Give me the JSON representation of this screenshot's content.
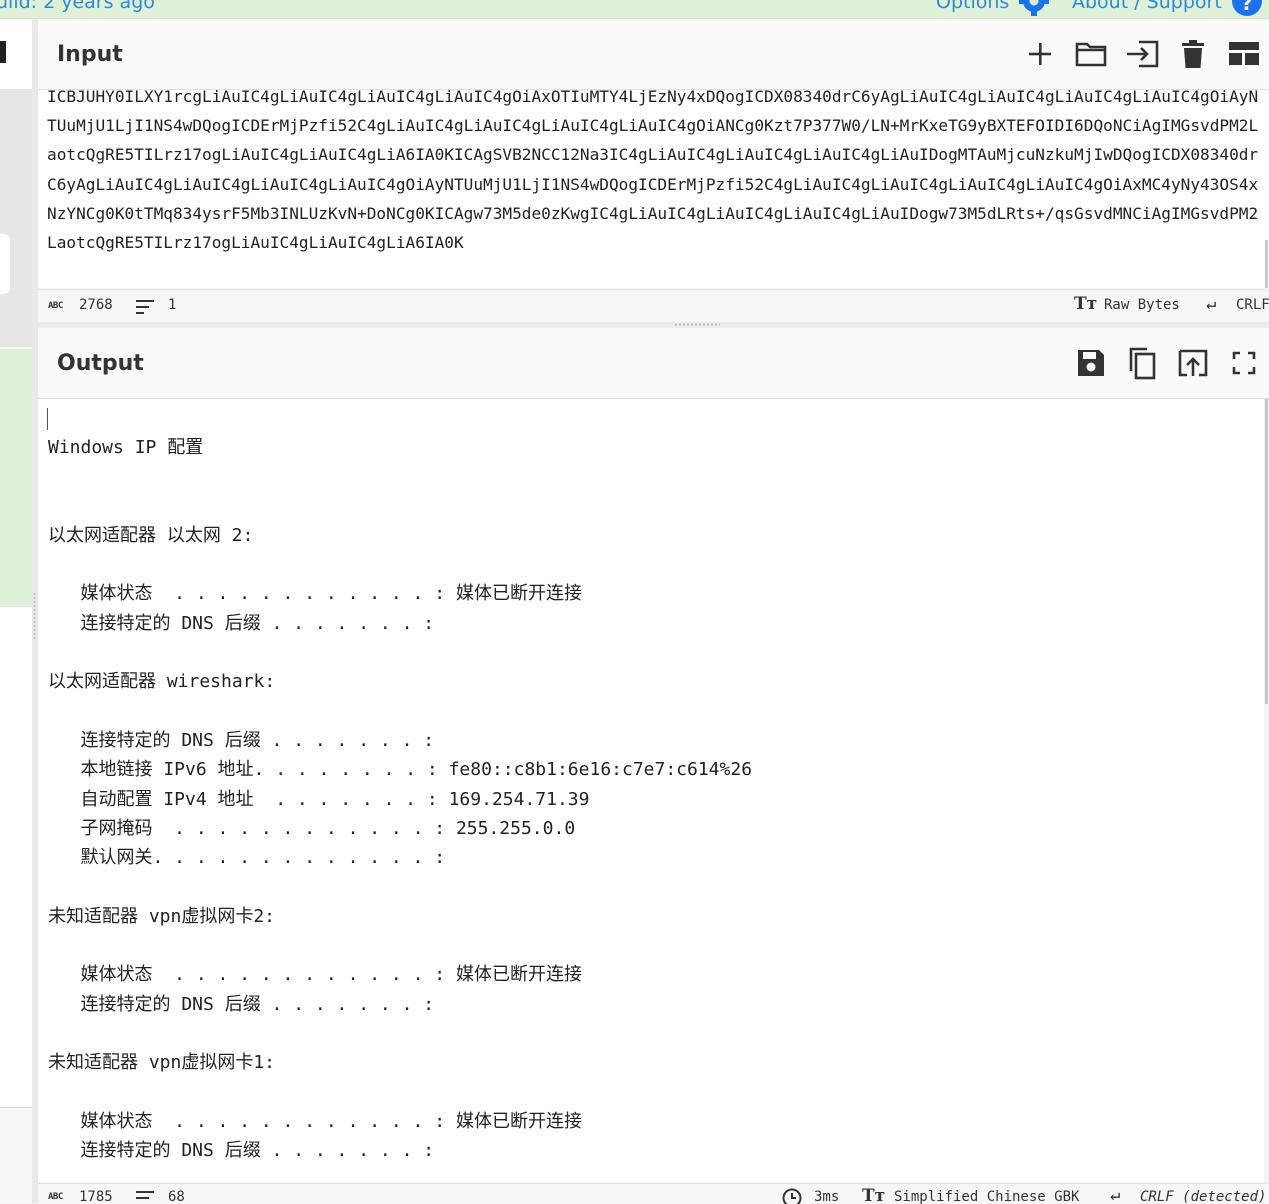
{
  "topbar": {
    "build_text": "uild: 2 years ago",
    "options_label": "Options",
    "about_label": "About / Support",
    "help_glyph": "?"
  },
  "input": {
    "title": "Input",
    "toolbar": {
      "add_icon": "plus-icon",
      "open_icon": "folder-icon",
      "import_icon": "sign-in-icon",
      "clear_icon": "trash-icon",
      "layout_icon": "layout-icon"
    },
    "text": "ICBJUHY0ILXY1rcgLiAuIC4gLiAuIC4gLiAuIC4gLiAuIC4gOiAxOTIuMTY4LjEzNy4xDQogICDX08340drC6yAgLiAuIC4gLiAuIC4gLiAuIC4gLiAuIC4gOiAyNTUuMjU1LjI1NS4wDQogICDErMjPzfi52C4gLiAuIC4gLiAuIC4gLiAuIC4gLiAuIC4gOiANCg0Kzt7P377W0/LN+MrKxeTG9yBXTEFOIDI6DQoNCiAgIMGsvdPM2LaotcQgRE5TILrz17ogLiAuIC4gLiAuIC4gLiA6IA0KICAgSVB2NCC12Na3IC4gLiAuIC4gLiAuIC4gLiAuIC4gLiAuIDogMTAuMjcuNzkuMjIwDQogICDX08340drC6yAgLiAuIC4gLiAuIC4gLiAuIC4gLiAuIC4gOiAyNTUuMjU1LjI1NS4wDQogICDErMjPzfi52C4gLiAuIC4gLiAuIC4gLiAuIC4gLiAuIC4gOiAxMC4yNy43OS4xNzYNCg0K0tTMq834ysrF5Mb3INLUzKvN+DoNCg0KICAgw73M5de0zKwgIC4gLiAuIC4gLiAuIC4gLiAuIC4gLiAuIDogw73M5dLRts+/qsGsvdMNCiAgIMGsvdPM2LaotcQgRE5TILrz17ogLiAuIC4gLiAuIC4gLiA6IA0K",
    "status": {
      "length": "2768",
      "lines": "1",
      "encoding": "Raw Bytes",
      "eol": "CRLF"
    }
  },
  "output": {
    "title": "Output",
    "toolbar": {
      "save_icon": "save-icon",
      "copy_icon": "copy-icon",
      "replace_icon": "upload-to-input-icon",
      "maximise_icon": "fullscreen-icon"
    },
    "text": "Windows IP 配置\n\n\n以太网适配器 以太网 2:\n\n   媒体状态  . . . . . . . . . . . . : 媒体已断开连接\n   连接特定的 DNS 后缀 . . . . . . . :\n\n以太网适配器 wireshark:\n\n   连接特定的 DNS 后缀 . . . . . . . :\n   本地链接 IPv6 地址. . . . . . . . : fe80::c8b1:6e16:c7e7:c614%26\n   自动配置 IPv4 地址  . . . . . . . : 169.254.71.39\n   子网掩码  . . . . . . . . . . . . : 255.255.0.0\n   默认网关. . . . . . . . . . . . . :\n\n未知适配器 vpn虚拟网卡2:\n\n   媒体状态  . . . . . . . . . . . . : 媒体已断开连接\n   连接特定的 DNS 后缀 . . . . . . . :\n\n未知适配器 vpn虚拟网卡1:\n\n   媒体状态  . . . . . . . . . . . . : 媒体已断开连接\n   连接特定的 DNS 后缀 . . . . . . . :",
    "status": {
      "length": "1785",
      "lines": "68",
      "time": "3ms",
      "encoding": "Simplified Chinese GBK",
      "eol": "CRLF (detected)"
    }
  }
}
